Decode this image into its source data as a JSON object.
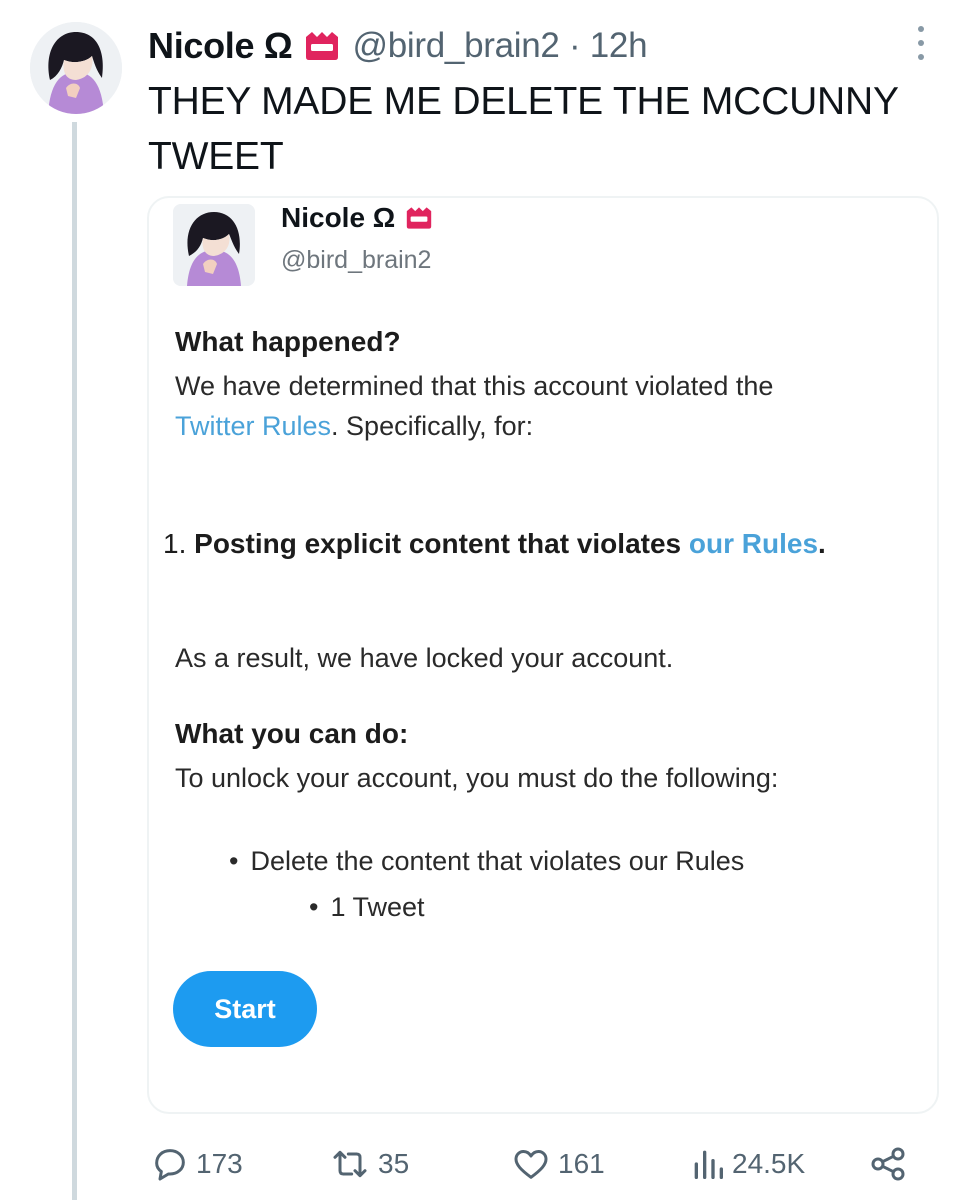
{
  "tweet": {
    "display_name": "Nicole Ω",
    "handle_time": "@bird_brain2 · 12h",
    "text": "THEY MADE ME DELETE THE MCCUNNY TWEET"
  },
  "card": {
    "display_name": "Nicole Ω",
    "handle": "@bird_brain2",
    "what_happened_heading": "What happened?",
    "violation_line1": "We have determined that this account violated the",
    "violation_link": "Twitter Rules",
    "violation_line2_rest": ". Specifically, for:",
    "rule_number": "1.",
    "rule_text": "Posting explicit content that violates",
    "rule_link": "our Rules",
    "rule_end": ".",
    "result_text": "As a result, we have locked your account.",
    "what_you_can_do_heading": "What you can do:",
    "unlock_text": "To unlock your account, you must do the following:",
    "bullet_1": "Delete the content that violates our Rules",
    "bullet_2": "1 Tweet",
    "start_label": "Start"
  },
  "actions": {
    "replies": "173",
    "retweets": "35",
    "likes": "161",
    "views": "24.5K"
  },
  "colors": {
    "accent": "#1d9bf0",
    "link": "#4aa2d9",
    "secondary_text": "#536471",
    "badge_red": "#e0245e"
  },
  "icons": [
    "more-icon",
    "reply-icon",
    "retweet-icon",
    "like-icon",
    "views-icon",
    "share-icon",
    "badge-icon"
  ]
}
